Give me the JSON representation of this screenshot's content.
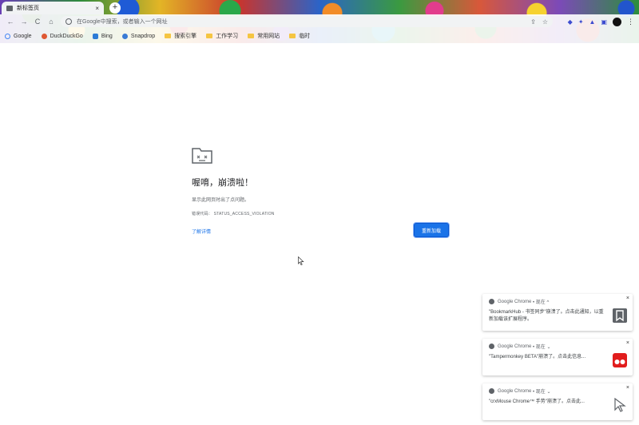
{
  "tab": {
    "title": "新标签页",
    "close": "×"
  },
  "newtab": "+",
  "toolbar": {
    "back": "←",
    "forward": "→",
    "reload": "C",
    "home": "⌂",
    "omnibox_placeholder": "在Google中搜索，或者输入一个网址",
    "share": "⇪",
    "star": "☆",
    "menu": "⋮"
  },
  "bookmarks": [
    {
      "label": "Google",
      "type": "site",
      "color": "#4285f4"
    },
    {
      "label": "DuckDuckGo",
      "type": "site",
      "color": "#de5833"
    },
    {
      "label": "Bing",
      "type": "site",
      "color": "#2b7bd6"
    },
    {
      "label": "Snapdrop",
      "type": "site",
      "color": "#3a7bd5"
    },
    {
      "label": "搜索引擎",
      "type": "folder"
    },
    {
      "label": "工作学习",
      "type": "folder"
    },
    {
      "label": "常用网站",
      "type": "folder"
    },
    {
      "label": "临时",
      "type": "folder"
    }
  ],
  "error": {
    "title": "喔唷，崩溃啦！",
    "description": "显示此网页时出了点问题。",
    "code_label": "错误代码：",
    "code": "STATUS_ACCESS_VIOLATION",
    "learn_more": "了解详情",
    "reload": "重新加载"
  },
  "notifications": [
    {
      "source": "Google Chrome",
      "time": "• 现在 ^",
      "close": "×",
      "body": "\"BookmarkHub - 书签同步\"崩溃了。点击此通知，以重新加载该扩展程序。",
      "icon": "bookmark-icon"
    },
    {
      "source": "Google Chrome",
      "time": "• 现在 ⌄",
      "close": "×",
      "body": "\"Tampermonkey BETA\"崩溃了。点击此信息...",
      "icon": "tampermonkey-icon"
    },
    {
      "source": "Google Chrome",
      "time": "• 现在 ⌄",
      "close": "×",
      "body": "\"crxMouse Chrome™ 手势\"崩溃了。点击此...",
      "icon": "mouse-cursor-icon"
    }
  ]
}
